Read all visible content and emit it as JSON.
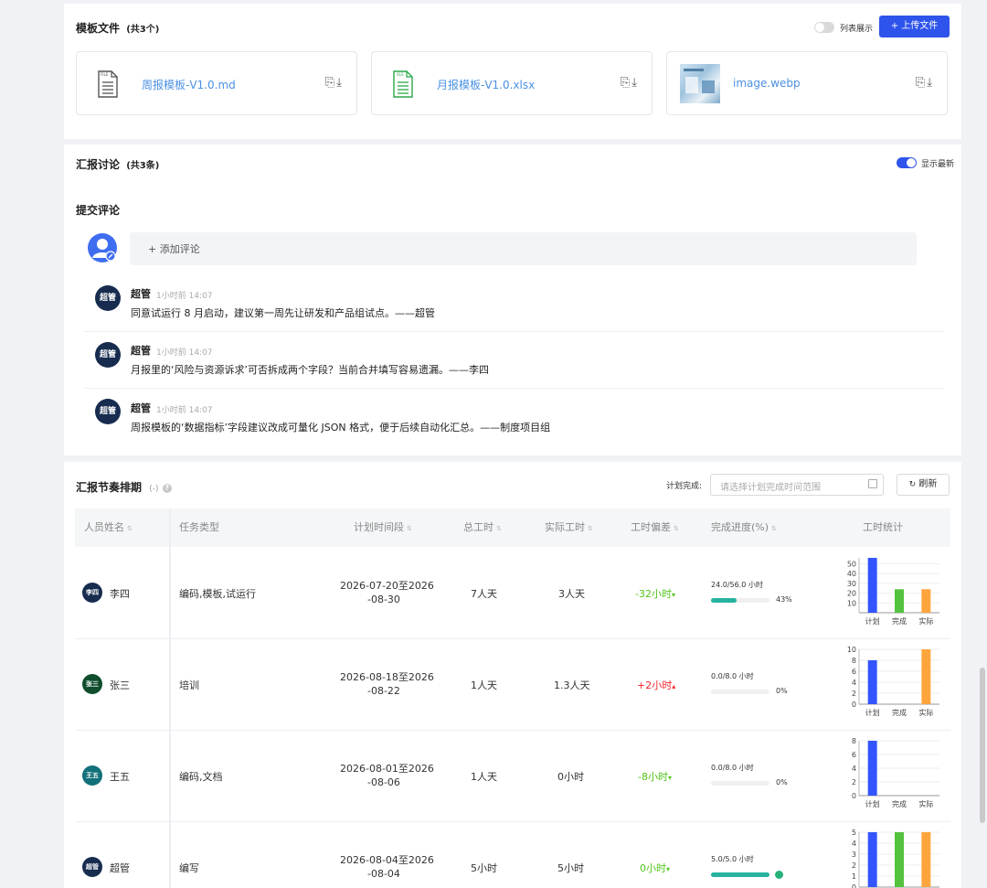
{
  "templates": {
    "title": "模板文件",
    "count": "(共3个)",
    "list_toggle_label": "列表展示",
    "upload_label": "+ 上传文件",
    "files": [
      {
        "name": "周报模板-V1.0.md",
        "icon": "md-file-icon",
        "icon_text": "FILE"
      },
      {
        "name": "月报模板-V1.0.xlsx",
        "icon": "xlsx-file-icon",
        "icon_text": "XLS"
      },
      {
        "name": "image.webp",
        "icon": "image-thumbnail",
        "icon_text": ""
      }
    ]
  },
  "discussion": {
    "title": "汇报讨论",
    "count": "(共3条)",
    "show_latest_label": "显示最新",
    "submit_title": "提交评论",
    "add_comment": "+ 添加评论",
    "comments": [
      {
        "avatar": "超管",
        "author": "超管",
        "time": "1小时前 14:07",
        "text": "同意试运行 8 月启动，建议第一周先让研发和产品组试点。——超管"
      },
      {
        "avatar": "超管",
        "author": "超管",
        "time": "1小时前 14:07",
        "text": "月报里的‘风险与资源诉求’可否拆成两个字段？当前合并填写容易遗漏。——李四"
      },
      {
        "avatar": "超管",
        "author": "超管",
        "time": "1小时前 14:07",
        "text": "周报模板的‘数据指标’字段建议改成可量化 JSON 格式，便于后续自动化汇总。——制度项目组"
      }
    ]
  },
  "schedule": {
    "title": "汇报节奏排期",
    "title_suffix": "(-)",
    "plan_label": "计划完成:",
    "date_placeholder": "请选择计划完成时间范围",
    "refresh_label": "刷新",
    "columns": [
      "人员姓名",
      "任务类型",
      "计划时间段",
      "总工时",
      "实际工时",
      "工时偏差",
      "完成进度(%)",
      "工时统计"
    ],
    "rows": [
      {
        "avatar": "李四",
        "avatar_color": "#172c4f",
        "name": "李四",
        "task": "编码,模板,试运行",
        "period_1": "2026-07-20至2026",
        "period_2": "-08-30",
        "total": "7人天",
        "actual": "3人天",
        "deviation": "-32小时",
        "dev_color": "#52c41a",
        "dev_arrow": "▾",
        "progress_text": "24.0/56.0 小时",
        "progress": 0.43,
        "progress_pct": "43%"
      },
      {
        "avatar": "张三",
        "avatar_color": "#0f4d2e",
        "name": "张三",
        "task": "培训",
        "period_1": "2026-08-18至2026",
        "period_2": "-08-22",
        "total": "1人天",
        "actual": "1.3人天",
        "deviation": "+2小时",
        "dev_color": "#f5222d",
        "dev_arrow": "▴",
        "progress_text": "0.0/8.0 小时",
        "progress": 0,
        "progress_pct": "0%"
      },
      {
        "avatar": "王五",
        "avatar_color": "#12707a",
        "name": "王五",
        "task": "编码,文档",
        "period_1": "2026-08-01至2026",
        "period_2": "-08-06",
        "total": "1人天",
        "actual": "0小时",
        "deviation": "-8小时",
        "dev_color": "#52c41a",
        "dev_arrow": "▾",
        "progress_text": "0.0/8.0 小时",
        "progress": 0,
        "progress_pct": "0%"
      },
      {
        "avatar": "超管",
        "avatar_color": "#172c4f",
        "name": "超管",
        "task": "编写",
        "period_1": "2026-08-04至2026",
        "period_2": "-08-04",
        "total": "5小时",
        "actual": "5小时",
        "deviation": "0小时",
        "dev_color": "#52c41a",
        "dev_arrow": "▾",
        "progress_text": "5.0/5.0 小时",
        "progress": 1,
        "progress_pct": ""
      }
    ]
  },
  "chart_data": [
    {
      "type": "bar",
      "categories": [
        "计划",
        "完成",
        "实际"
      ],
      "values": [
        56,
        24,
        24
      ],
      "ylim": [
        0,
        56
      ],
      "yticks": [
        "50",
        "40",
        "30",
        "20",
        "10"
      ],
      "colors": [
        "#3355ff",
        "#55c23f",
        "#ffa53d"
      ]
    },
    {
      "type": "bar",
      "categories": [
        "计划",
        "完成",
        "实际"
      ],
      "values": [
        8,
        0,
        10
      ],
      "ylim": [
        0,
        10
      ],
      "yticks": [
        "10",
        "8",
        "6",
        "4",
        "2",
        "0"
      ],
      "colors": [
        "#3355ff",
        "#55c23f",
        "#ffa53d"
      ]
    },
    {
      "type": "bar",
      "categories": [
        "计划",
        "完成",
        "实际"
      ],
      "values": [
        8,
        0,
        0
      ],
      "ylim": [
        0,
        8
      ],
      "yticks": [
        "8",
        "6",
        "4",
        "2",
        "0"
      ],
      "colors": [
        "#3355ff",
        "#55c23f",
        "#ffa53d"
      ]
    },
    {
      "type": "bar",
      "categories": [
        "计划",
        "完成",
        "实际"
      ],
      "values": [
        5,
        5,
        5
      ],
      "ylim": [
        0,
        5
      ],
      "yticks": [
        "5",
        "4",
        "3",
        "2",
        "1",
        "0"
      ],
      "colors": [
        "#3355ff",
        "#55c23f",
        "#ffa53d"
      ]
    }
  ]
}
